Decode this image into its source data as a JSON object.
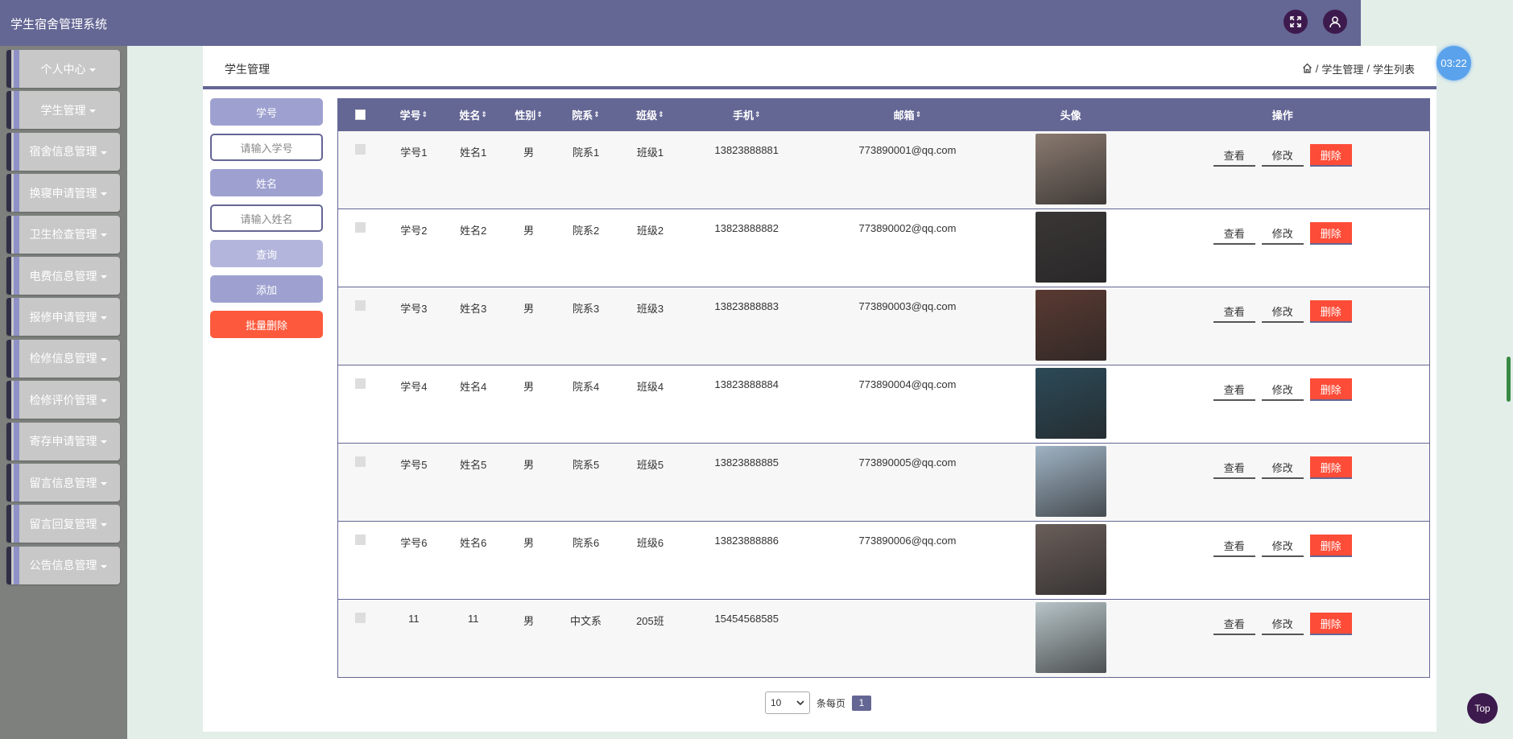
{
  "app": {
    "title": "学生宿舍管理系统",
    "timer": "03:22",
    "top_label": "Top"
  },
  "sidebar": {
    "items": [
      {
        "label": "个人中心"
      },
      {
        "label": "学生管理"
      },
      {
        "label": "宿舍信息管理"
      },
      {
        "label": "换寝申请管理"
      },
      {
        "label": "卫生检查管理"
      },
      {
        "label": "电费信息管理"
      },
      {
        "label": "报修申请管理"
      },
      {
        "label": "检修信息管理"
      },
      {
        "label": "检修评价管理"
      },
      {
        "label": "寄存申请管理"
      },
      {
        "label": "留言信息管理"
      },
      {
        "label": "留言回复管理"
      },
      {
        "label": "公告信息管理"
      }
    ]
  },
  "header": {
    "title": "学生管理",
    "breadcrumb": [
      "学生管理",
      "学生列表"
    ],
    "separator": "/"
  },
  "search": {
    "student_no_label": "学号",
    "student_no_placeholder": "请输入学号",
    "name_label": "姓名",
    "name_placeholder": "请输入姓名",
    "query": "查询",
    "add": "添加",
    "batch_delete": "批量删除"
  },
  "table": {
    "columns": [
      "学号",
      "姓名",
      "性别",
      "院系",
      "班级",
      "手机",
      "邮箱",
      "头像",
      "操作"
    ],
    "sort_glyph": "⇕",
    "actions": {
      "view": "查看",
      "edit": "修改",
      "delete": "删除"
    },
    "rows": [
      {
        "xh": "学号1",
        "xm": "姓名1",
        "xb": "男",
        "yx": "院系1",
        "bj": "班级1",
        "sj": "13823888881",
        "yj": "773890001@qq.com",
        "avatar_color": "#8a7a70"
      },
      {
        "xh": "学号2",
        "xm": "姓名2",
        "xb": "男",
        "yx": "院系2",
        "bj": "班级2",
        "sj": "13823888882",
        "yj": "773890002@qq.com",
        "avatar_color": "#3a3636"
      },
      {
        "xh": "学号3",
        "xm": "姓名3",
        "xb": "男",
        "yx": "院系3",
        "bj": "班级3",
        "sj": "13823888883",
        "yj": "773890003@qq.com",
        "avatar_color": "#5a3a32"
      },
      {
        "xh": "学号4",
        "xm": "姓名4",
        "xb": "男",
        "yx": "院系4",
        "bj": "班级4",
        "sj": "13823888884",
        "yj": "773890004@qq.com",
        "avatar_color": "#2c4a58"
      },
      {
        "xh": "学号5",
        "xm": "姓名5",
        "xb": "男",
        "yx": "院系5",
        "bj": "班级5",
        "sj": "13823888885",
        "yj": "773890005@qq.com",
        "avatar_color": "#9fb3c4"
      },
      {
        "xh": "学号6",
        "xm": "姓名6",
        "xb": "男",
        "yx": "院系6",
        "bj": "班级6",
        "sj": "13823888886",
        "yj": "773890006@qq.com",
        "avatar_color": "#6a5e5a"
      },
      {
        "xh": "11",
        "xm": "11",
        "xb": "男",
        "yx": "中文系",
        "bj": "205班",
        "sj": "15454568585",
        "yj": "",
        "avatar_color": "#b7c4c8"
      }
    ]
  },
  "pagination": {
    "page_size": "10",
    "per_page_label": "条每页",
    "current_page": "1"
  },
  "colors": {
    "primary": "#646694",
    "danger": "#fd4c37",
    "accent_light": "#9ea1d0"
  }
}
